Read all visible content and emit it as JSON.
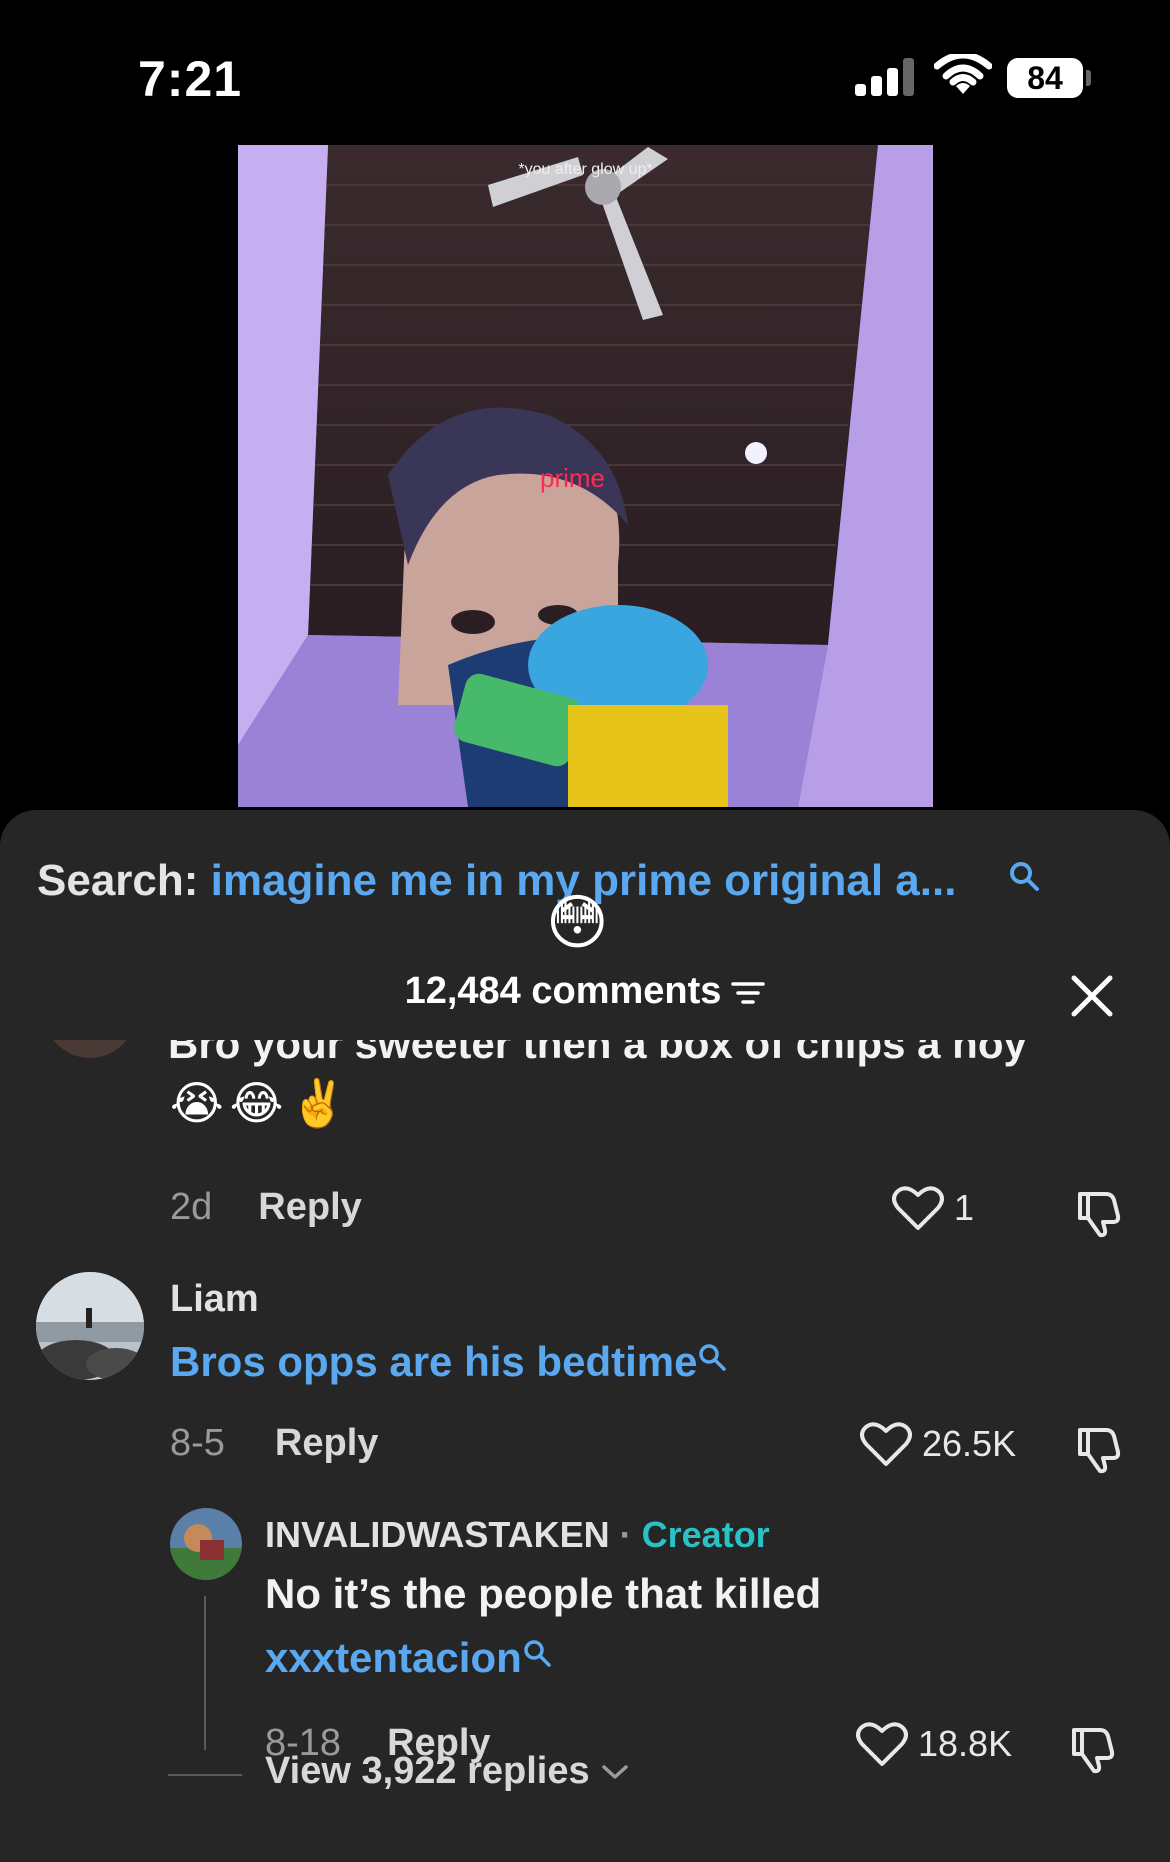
{
  "status_bar": {
    "time": "7:21",
    "battery": "84"
  },
  "video": {
    "caption": "*you after glow up*",
    "overlay_text": "prime"
  },
  "search": {
    "label": "Search:",
    "query": "imagine me in my prime original a..."
  },
  "emoji_reaction": "😳",
  "comments": {
    "count_label": "12,484 comments",
    "partial_comment": {
      "text": "Bro your sweeter then a box of chips a hoy",
      "emojis": "😭😂✌️",
      "date": "2d",
      "reply_label": "Reply",
      "likes": "1"
    },
    "liam_comment": {
      "username": "Liam",
      "text": "Bros opps are his bedtime",
      "date": "8-5",
      "reply_label": "Reply",
      "likes": "26.5K"
    },
    "creator_reply": {
      "username": "INVALIDWASTAKEN",
      "separator": " · ",
      "creator_tag": "Creator",
      "text": "No it’s the people that killed",
      "link": "xxxtentacion",
      "date": "8-18",
      "reply_label": "Reply",
      "likes": "18.8K"
    },
    "view_replies_label": "View 3,922 replies"
  },
  "colors": {
    "sheet_bg": "#262626",
    "link_blue": "#5aa8f0",
    "creator_teal": "#29c2c6"
  },
  "icons": [
    "search-icon",
    "filter-icon",
    "close-icon",
    "heart-icon",
    "dislike-icon",
    "chevron-down-icon",
    "wifi-icon",
    "signal-icon",
    "battery-icon"
  ]
}
